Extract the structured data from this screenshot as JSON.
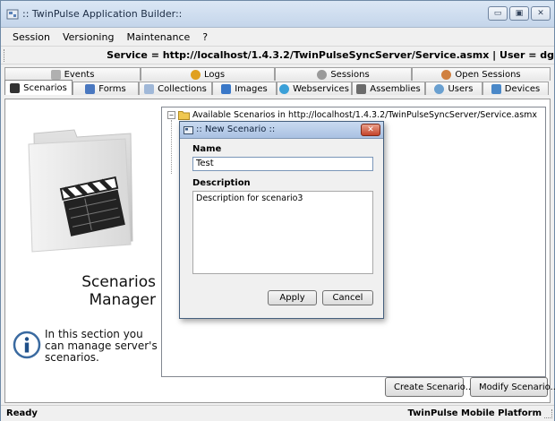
{
  "window": {
    "title": ":: TwinPulse Application Builder::",
    "controls": {
      "minimize": "▭",
      "maximize": "▣",
      "close": "✕"
    }
  },
  "menu": {
    "items": [
      {
        "label": "Session"
      },
      {
        "label": "Versioning"
      },
      {
        "label": "Maintenance"
      },
      {
        "label": "?"
      }
    ]
  },
  "infobar": {
    "text": "Service = http://localhost/1.4.3.2/TwinPulseSyncServer/Service.asmx  |  User = dg"
  },
  "tabs": {
    "row1": [
      {
        "label": "Events",
        "icon": "events-icon",
        "color": "#b0b0b0"
      },
      {
        "label": "Logs",
        "icon": "logs-icon",
        "color": "#e0a020"
      },
      {
        "label": "Sessions",
        "icon": "sessions-icon",
        "color": "#9a9a9a"
      },
      {
        "label": "Open Sessions",
        "icon": "open-sessions-icon",
        "color": "#d08040"
      }
    ],
    "row2": [
      {
        "label": "Scenarios",
        "icon": "scenarios-icon",
        "color": "#333333"
      },
      {
        "label": "Forms",
        "icon": "forms-icon",
        "color": "#4a78c0"
      },
      {
        "label": "Collections",
        "icon": "collections-icon",
        "color": "#a0b8d8"
      },
      {
        "label": "Images",
        "icon": "images-icon",
        "color": "#3a78c8"
      },
      {
        "label": "Webservices",
        "icon": "webservices-icon",
        "color": "#3aa0d8"
      },
      {
        "label": "Assemblies",
        "icon": "assemblies-icon",
        "color": "#6b6b6b"
      },
      {
        "label": "Users",
        "icon": "users-icon",
        "color": "#6aa0d0"
      },
      {
        "label": "Devices",
        "icon": "devices-icon",
        "color": "#4a88c8"
      }
    ]
  },
  "section": {
    "title_line1": "Scenarios",
    "title_line2": "Manager",
    "info": "In this section you can manage server's scenarios."
  },
  "tree": {
    "expander": "−",
    "root_label": "Available Scenarios in http://localhost/1.4.3.2/TwinPulseSyncServer/Service.asmx"
  },
  "dialog": {
    "title": ":: New Scenario ::",
    "close": "✕",
    "name_label": "Name",
    "name_value": "Test",
    "description_label": "Description",
    "description_value": "Description for scenario3",
    "apply_label": "Apply",
    "cancel_label": "Cancel"
  },
  "actions": {
    "create_label": "Create Scenario...",
    "modify_label": "Modify Scenario..."
  },
  "status": {
    "left": "Ready",
    "right": "TwinPulse Mobile Platform"
  }
}
